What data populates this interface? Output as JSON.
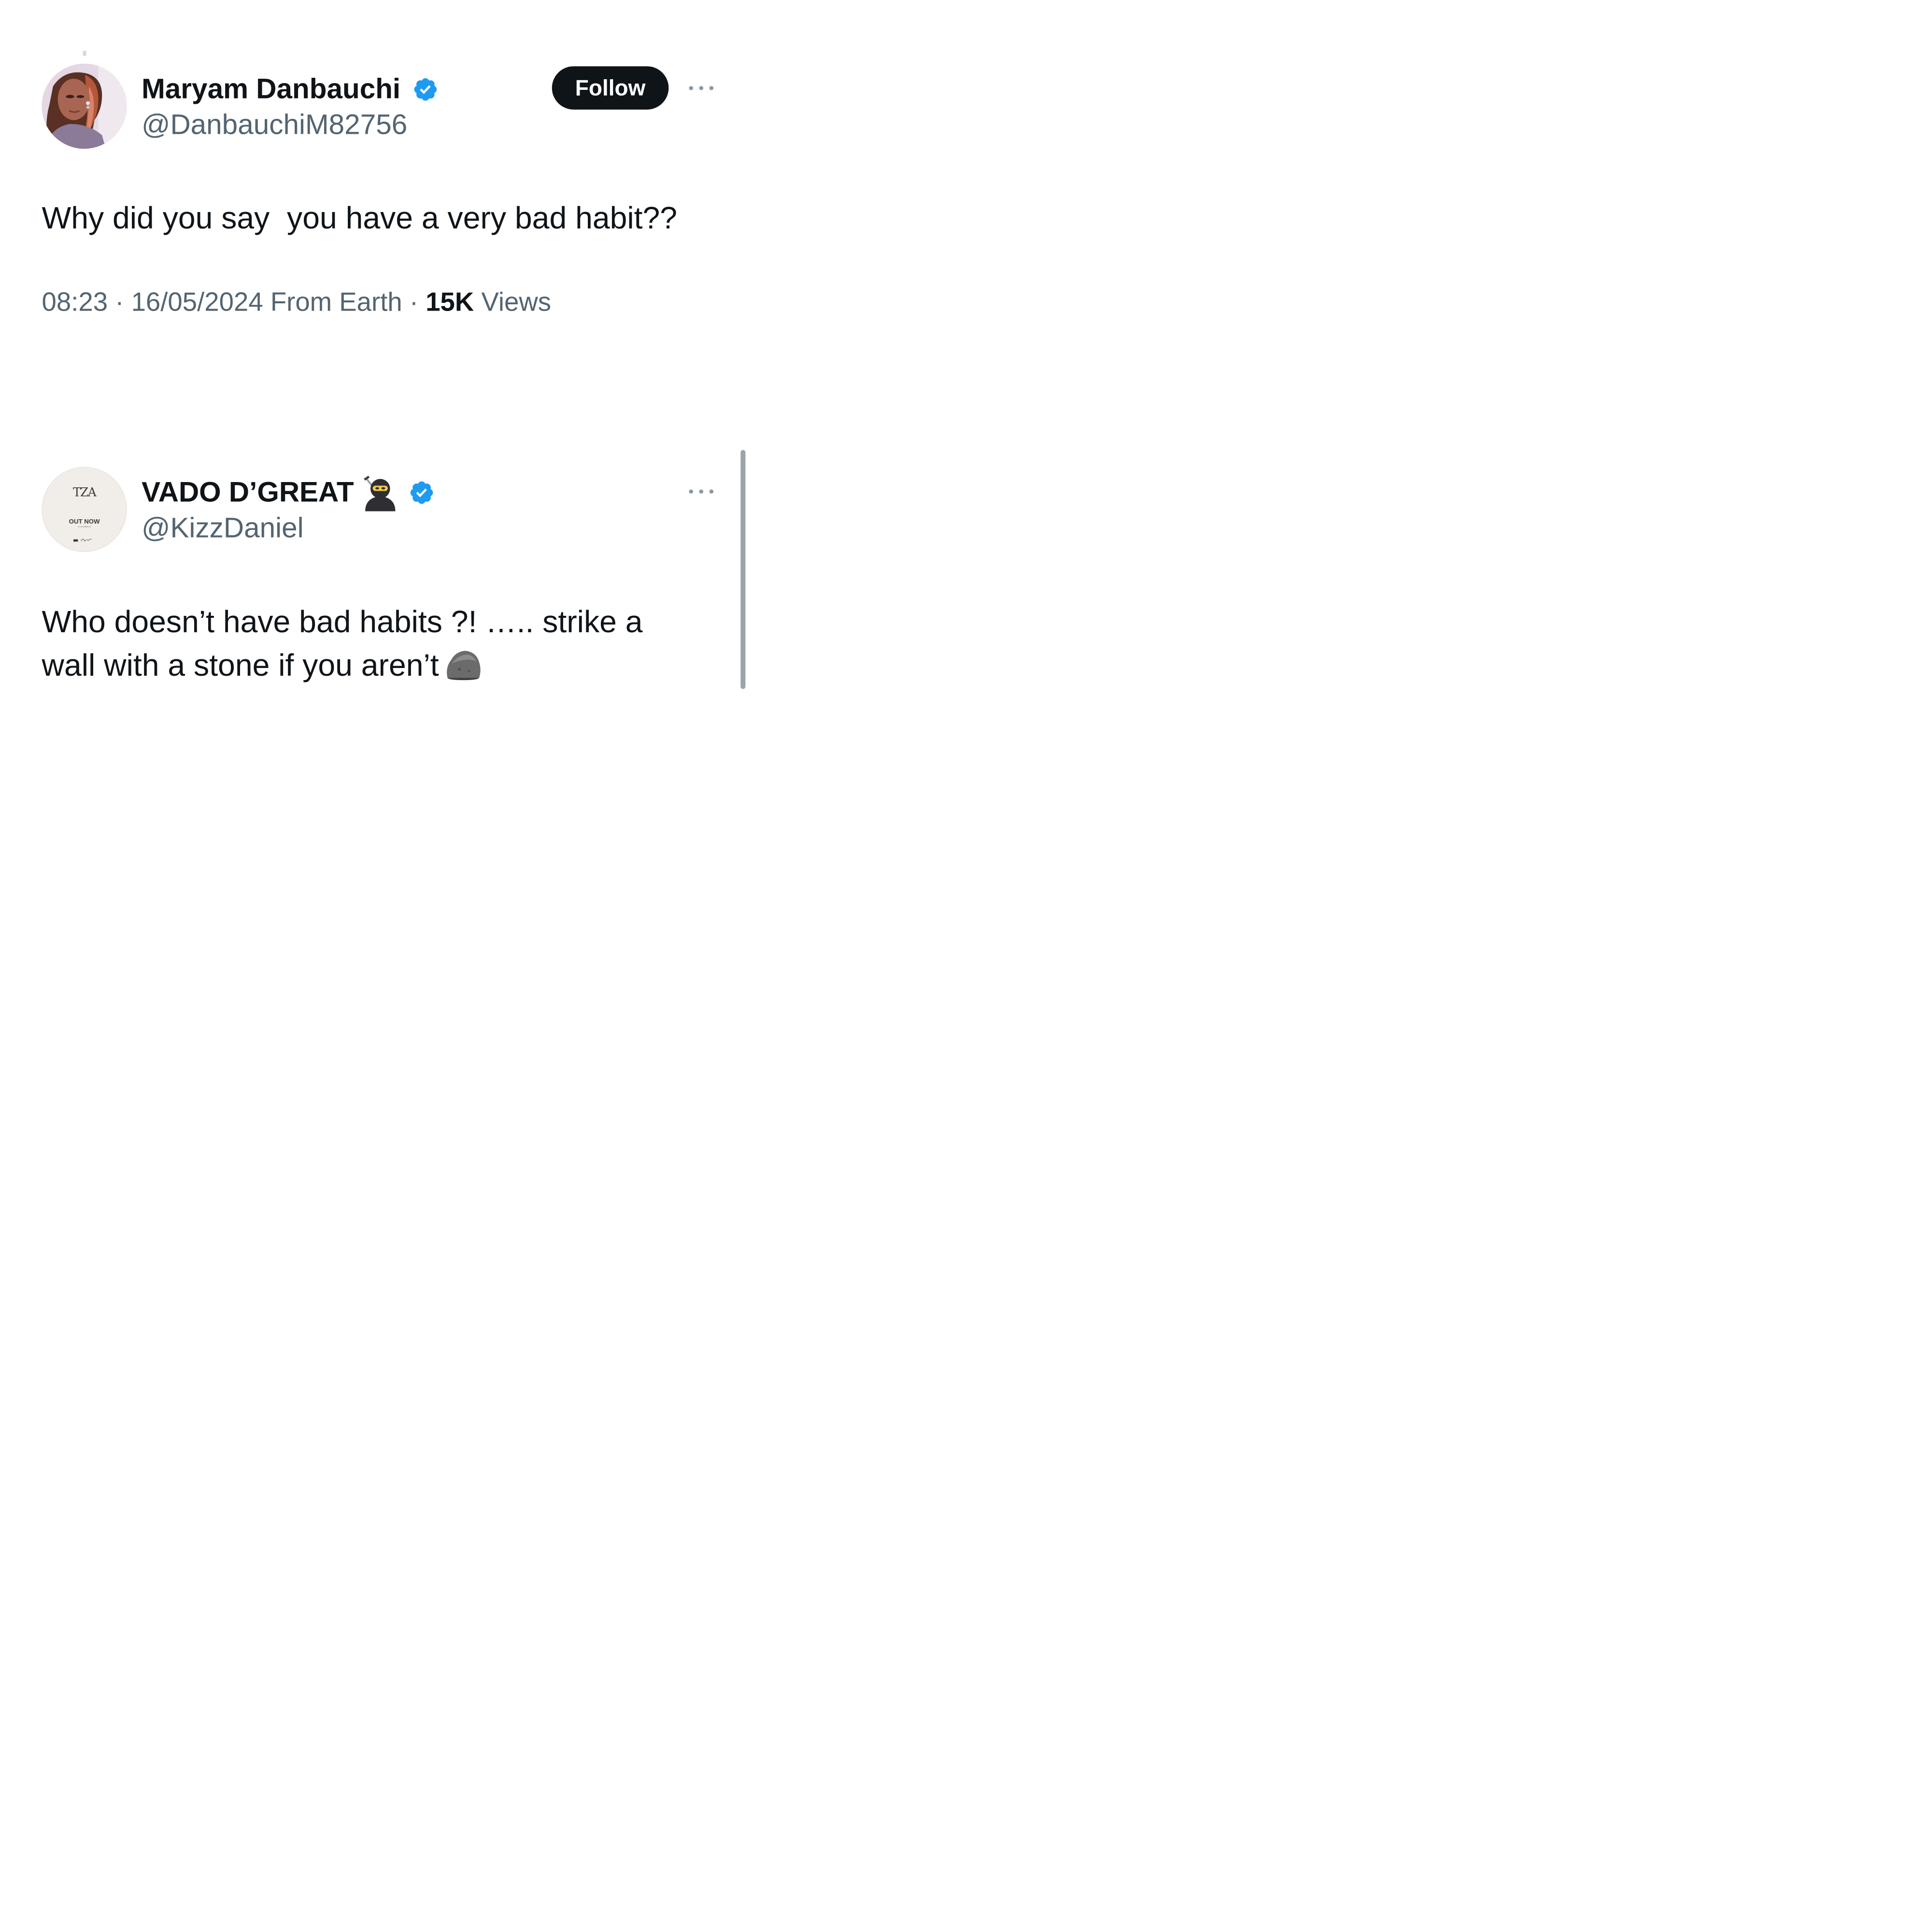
{
  "colors": {
    "text_primary": "#0f1419",
    "text_secondary": "#536471",
    "verified_blue": "#1d9bf0",
    "follow_button_bg": "#0f1419",
    "follow_button_text": "#ffffff"
  },
  "tweets": [
    {
      "author": {
        "display_name": "Maryam Danbauchi",
        "handle": "@DanbauchiM82756",
        "verified": true
      },
      "follow_label": "Follow",
      "more_icon": "more-horizontal-icon",
      "text": "Why did you say  you have a very bad habit??",
      "meta": {
        "time": "08:23",
        "separator": "·",
        "date": "16/05/2024",
        "location": "From Earth",
        "views_count": "15K",
        "views_label": "Views"
      }
    },
    {
      "author": {
        "display_name": "VADO D’GREAT",
        "handle": "@KizzDaniel",
        "verified": true,
        "name_emoji": "ninja-emoji"
      },
      "avatar": {
        "logo": "TZA",
        "caption": "OUT NOW",
        "subcaption": "on all platforms"
      },
      "more_icon": "more-horizontal-icon",
      "text": "Who doesn’t have bad habits ?! ….. strike a wall with a stone if you aren’t",
      "text_emoji": "rock-emoji"
    }
  ]
}
